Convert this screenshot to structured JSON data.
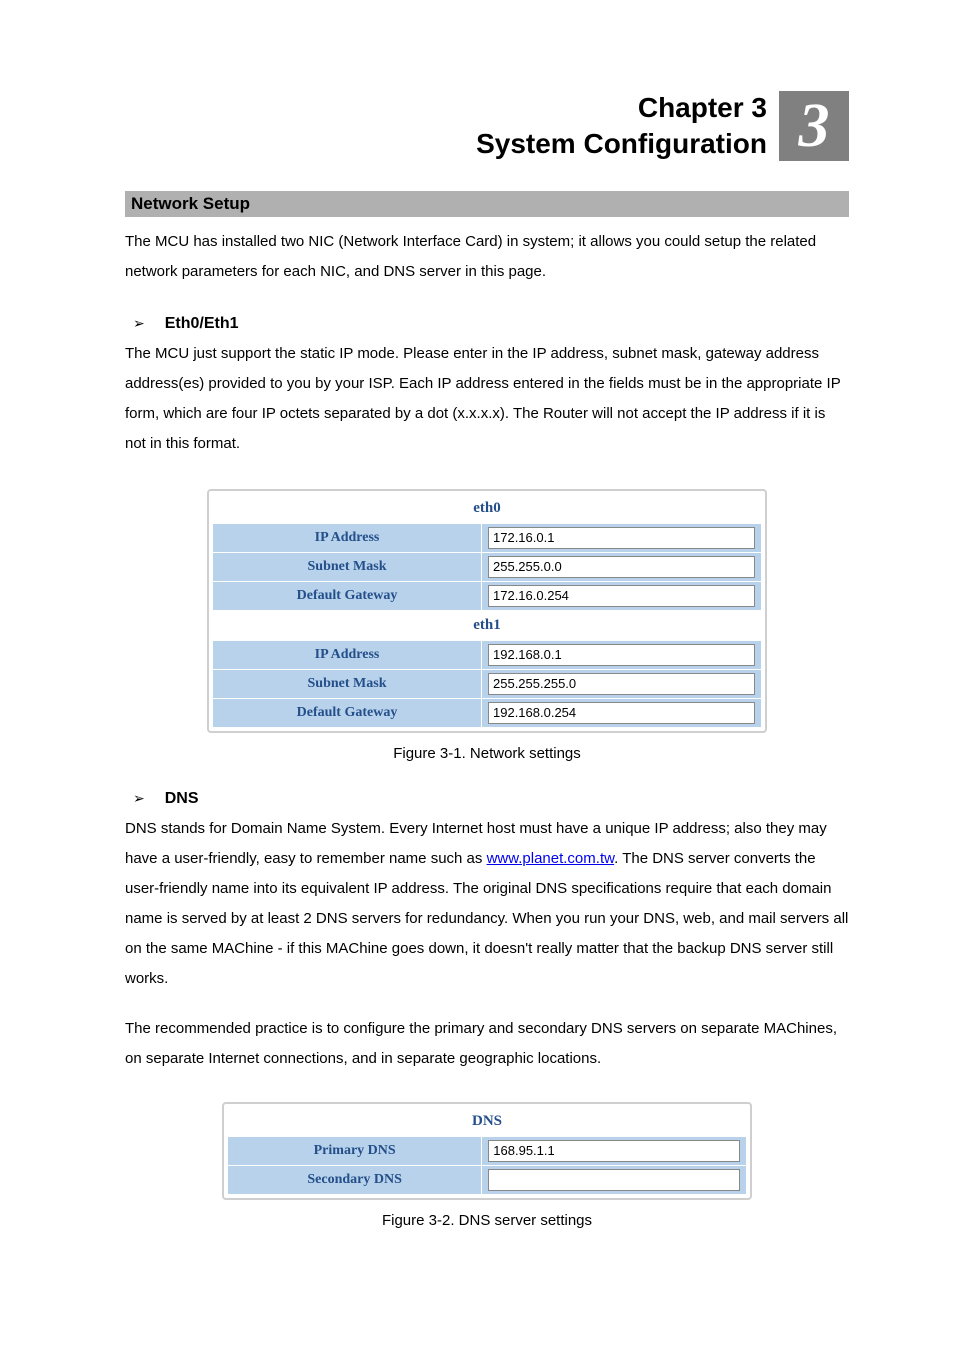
{
  "chapter": {
    "line1": "Chapter 3",
    "line2": "System Configuration",
    "number": "3"
  },
  "section1": {
    "title": "Network Setup",
    "intro": "The MCU has installed two NIC (Network Interface Card) in system; it allows you could setup the related network parameters for each NIC, and DNS server in this page."
  },
  "eth": {
    "heading": "Eth0/Eth1",
    "text": "The MCU just support the static IP mode. Please enter in the IP address, subnet mask, gateway address address(es) provided to you by your ISP. Each IP address entered in the fields must be in the appropriate IP form, which are four IP octets separated by a dot (x.x.x.x). The Router will not accept the IP address if it is not in this format.",
    "group0": "eth0",
    "group1": "eth1",
    "labels": {
      "ip": "IP Address",
      "mask": "Subnet Mask",
      "gw": "Default Gateway"
    },
    "eth0": {
      "ip": "172.16.0.1",
      "mask": "255.255.0.0",
      "gw": "172.16.0.254"
    },
    "eth1": {
      "ip": "192.168.0.1",
      "mask": "255.255.255.0",
      "gw": "192.168.0.254"
    },
    "caption": "Figure 3-1. Network settings"
  },
  "dns": {
    "heading": "DNS",
    "text_pre": "DNS stands for Domain Name System. Every Internet host must have a unique IP address; also they may have a user-friendly, easy to remember name such as ",
    "link_text": "www.planet.com.tw",
    "text_post": ". The DNS server converts the user-friendly name into its equivalent IP address. The original DNS specifications require that each domain name is served by at least 2 DNS servers for redundancy. When you run your DNS, web, and mail servers all on the same MAChine - if this MAChine goes down, it doesn't really matter that the backup DNS server still works.",
    "text2": "The recommended practice is to configure the primary and secondary DNS servers on separate MAChines, on separate Internet connections, and in separate geographic locations.",
    "group": "DNS",
    "labels": {
      "primary": "Primary DNS",
      "secondary": "Secondary DNS"
    },
    "values": {
      "primary": "168.95.1.1",
      "secondary": ""
    },
    "caption": "Figure 3-2. DNS server settings"
  }
}
